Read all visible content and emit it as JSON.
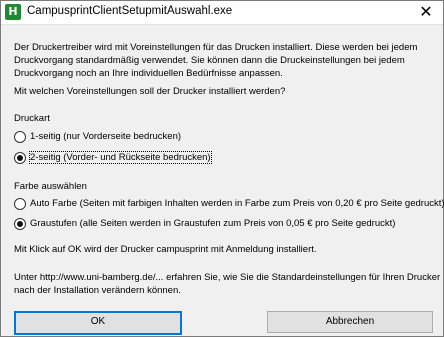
{
  "window": {
    "title": "CampusprintClientSetupmitAuswahl.exe",
    "icon_letter": "H",
    "icon": "app-icon",
    "close_glyph": "✕"
  },
  "intro": {
    "line1": "Der Druckertreiber wird mit Voreinstellungen für das Drucken installiert. Diese werden bei jedem",
    "line2": "Druckvorgang standardmäßig verwendet. Sie können dann die Druckeinstellungen bei jedem",
    "line3": "Druckvorgang noch an Ihre individuellen Bedürfnisse anpassen."
  },
  "question": "Mit welchen Voreinstellungen soll der Drucker installiert werden?",
  "druckart": {
    "heading": "Druckart",
    "options": [
      {
        "label": "1-seitig (nur Vorderseite bedrucken)",
        "checked": false
      },
      {
        "label": "2-seitig (Vorder- und Rückseite bedrucken)",
        "checked": true
      }
    ]
  },
  "farbe": {
    "heading": "Farbe auswählen",
    "options": [
      {
        "label": "Auto Farbe (Seiten mit farbigen Inhalten werden in Farbe zum Preis von 0,20 € pro Seite gedruckt)",
        "checked": false
      },
      {
        "label": "Graustufen (alle Seiten werden in Graustufen zum Preis von 0,05 € pro Seite gedruckt)",
        "checked": true
      }
    ]
  },
  "ok_info": "Mit Klick auf OK wird der Drucker campusprint mit Anmeldung installiert.",
  "link_info": {
    "line1": "Unter http://www.uni-bamberg.de/... erfahren Sie, wie Sie die Standardeinstellungen für Ihren Drucker",
    "line2": "nach der Installation verändern können."
  },
  "buttons": {
    "ok": "OK",
    "cancel": "Abbrechen"
  }
}
